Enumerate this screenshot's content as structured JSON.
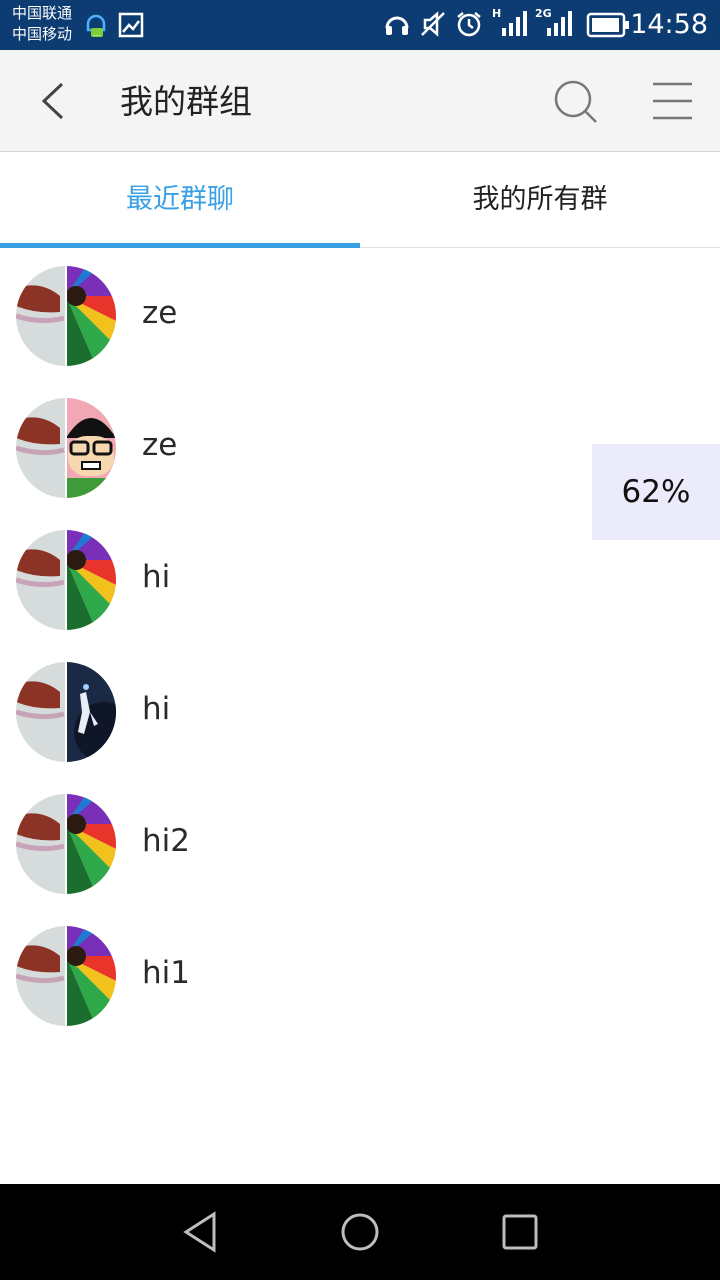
{
  "status_bar": {
    "carrier_1": "中国联通",
    "carrier_2": "中国移动",
    "network_1": "H",
    "network_2": "2G",
    "time": "14:58",
    "icons": [
      "headset-icon",
      "vibrate-off-icon",
      "alarm-icon",
      "signal-icon",
      "battery-icon",
      "notification-icon",
      "image-icon"
    ]
  },
  "toolbar": {
    "title": "我的群组",
    "back_icon": "chevron-left-icon",
    "search_icon": "search-icon",
    "menu_icon": "menu-icon"
  },
  "tabs": [
    {
      "label": "最近群聊",
      "active": true
    },
    {
      "label": "我的所有群",
      "active": false
    }
  ],
  "accent_color": "#3aa0e6",
  "groups": [
    {
      "name": "ze",
      "avatar": "food-and-color-wheel"
    },
    {
      "name": "ze",
      "avatar": "food-and-cartoon-face"
    },
    {
      "name": "hi",
      "avatar": "food-and-color-wheel"
    },
    {
      "name": "hi",
      "avatar": "food-and-space-figure"
    },
    {
      "name": "hi2",
      "avatar": "food-and-color-wheel"
    },
    {
      "name": "hi1",
      "avatar": "food-and-color-wheel"
    }
  ],
  "progress": {
    "text": "62%",
    "value": 0.62
  },
  "navbar": {
    "icons": [
      "back-triangle-icon",
      "home-circle-icon",
      "recents-square-icon"
    ]
  }
}
